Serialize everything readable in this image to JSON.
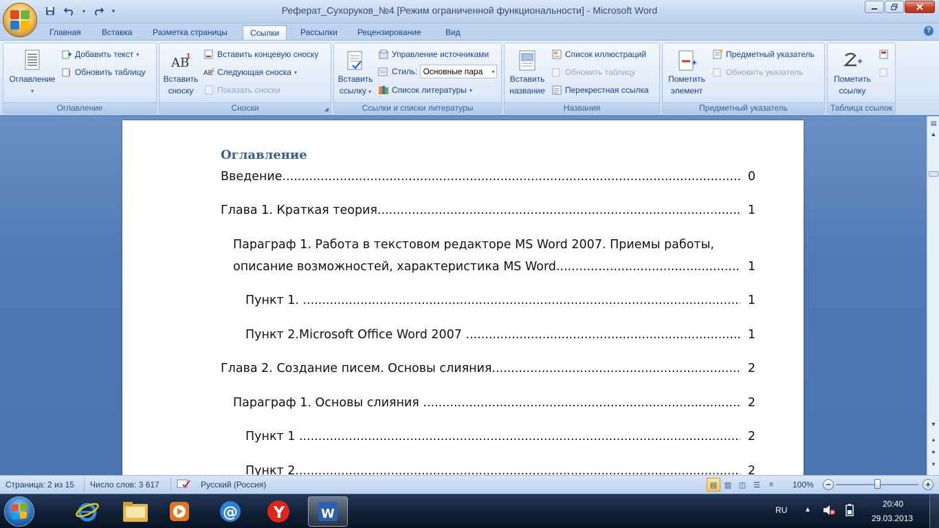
{
  "window": {
    "title": "Реферат_Сухоруков_№4 [Режим ограниченной функциональности]  -  Microsoft Word"
  },
  "tabs": [
    {
      "label": "Главная"
    },
    {
      "label": "Вставка"
    },
    {
      "label": "Разметка страницы"
    },
    {
      "label": "Ссылки",
      "active": true
    },
    {
      "label": "Рассылки"
    },
    {
      "label": "Рецензирование"
    },
    {
      "label": "Вид"
    }
  ],
  "ribbon": {
    "toc_group": {
      "label": "Оглавление",
      "toc_button": "Оглавление",
      "add_text": "Добавить текст",
      "update_table": "Обновить таблицу"
    },
    "footnotes_group": {
      "label": "Сноски",
      "insert_footnote_1": "Вставить",
      "insert_footnote_2": "сноску",
      "insert_endnote": "Вставить концевую сноску",
      "next_footnote": "Следующая сноска",
      "show_notes": "Показать сноски"
    },
    "citations_group": {
      "label": "Ссылки и списки литературы",
      "insert_citation_1": "Вставить",
      "insert_citation_2": "ссылку",
      "manage_sources": "Управление источниками",
      "style_label": "Стиль:",
      "style_value": "Основные пара",
      "bibliography": "Список литературы"
    },
    "captions_group": {
      "label": "Названия",
      "insert_caption_1": "Вставить",
      "insert_caption_2": "название",
      "table_of_figures": "Список иллюстраций",
      "update_table": "Обновить таблицу",
      "cross_reference": "Перекрестная ссылка"
    },
    "index_group": {
      "label": "Предметный указатель",
      "mark_entry_1": "Пометить",
      "mark_entry_2": "элемент",
      "insert_index": "Предметный указатель",
      "update_index": "Обновить указатель"
    },
    "toa_group": {
      "label": "Таблица ссылок",
      "mark_citation_1": "Пометить",
      "mark_citation_2": "ссылку"
    }
  },
  "document": {
    "heading": "Оглавление",
    "toc": [
      {
        "text": "Введение",
        "page": "0"
      },
      {
        "text": "Глава 1. Краткая теория.",
        "page": "1"
      },
      {
        "text": "Параграф 1. Работа в текстовом редакторе MS Word 2007. Приемы работы,",
        "page": ""
      },
      {
        "text": "описание возможностей, характеристика MS Word",
        "page": "1"
      },
      {
        "text": "Пункт 1. ",
        "page": "1"
      },
      {
        "text": "Пункт 2.Microsoft Office Word 2007 ",
        "page": "1"
      },
      {
        "text": "Глава 2. Создание писем. Основы слияния.",
        "page": "2"
      },
      {
        "text": "Параграф 1. Основы слияния ",
        "page": "2"
      },
      {
        "text": "Пункт 1 ",
        "page": "2"
      },
      {
        "text": "Пункт 2",
        "page": "2"
      }
    ]
  },
  "statusbar": {
    "page": "Страница: 2 из 15",
    "words": "Число слов: 3 617",
    "language": "Русский (Россия)",
    "zoom": "100%",
    "zoom_level_percent": 100
  },
  "taskbar": {
    "lang": "RU",
    "time": "20:40",
    "date": "29.03.2013"
  },
  "colors": {
    "heading": "#365f91",
    "ribbon_text": "#15428b"
  }
}
